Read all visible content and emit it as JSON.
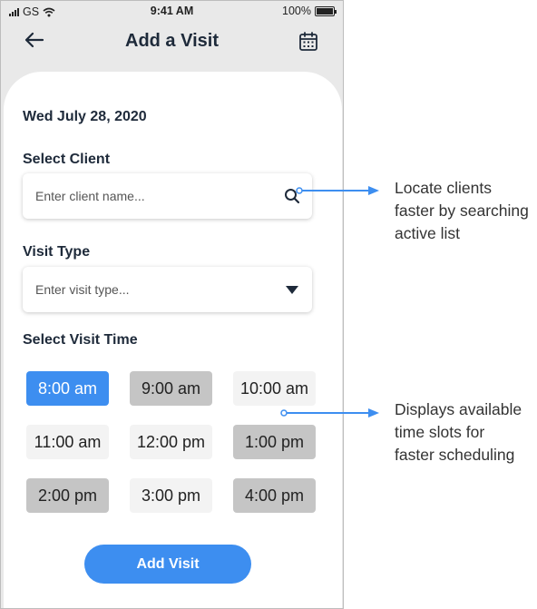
{
  "status_bar": {
    "carrier": "GS",
    "time": "9:41 AM",
    "battery": "100%"
  },
  "header": {
    "title": "Add a Visit",
    "back_icon": "arrow-left-icon",
    "calendar_icon": "calendar-icon"
  },
  "form": {
    "date": "Wed July 28, 2020",
    "client_label": "Select Client",
    "client_placeholder": "Enter client name...",
    "visit_type_label": "Visit Type",
    "visit_type_placeholder": "Enter visit type...",
    "time_label": "Select Visit Time",
    "time_slots": [
      {
        "label": "8:00 am",
        "state": "selected"
      },
      {
        "label": "9:00 am",
        "state": "unavailable"
      },
      {
        "label": "10:00 am",
        "state": "available"
      },
      {
        "label": "11:00 am",
        "state": "available"
      },
      {
        "label": "12:00 pm",
        "state": "available"
      },
      {
        "label": "1:00 pm",
        "state": "unavailable"
      },
      {
        "label": "2:00 pm",
        "state": "unavailable"
      },
      {
        "label": "3:00 pm",
        "state": "available"
      },
      {
        "label": "4:00 pm",
        "state": "unavailable"
      }
    ],
    "submit_label": "Add Visit"
  },
  "annotations": {
    "search": [
      "Locate clients",
      "faster by searching",
      "active list"
    ],
    "slots": [
      "Displays available",
      "time slots for",
      "faster scheduling"
    ]
  },
  "colors": {
    "accent": "#3d8ef0",
    "unavailable": "#c5c5c5",
    "available": "#f3f3f3",
    "background": "#e9e9e9"
  }
}
